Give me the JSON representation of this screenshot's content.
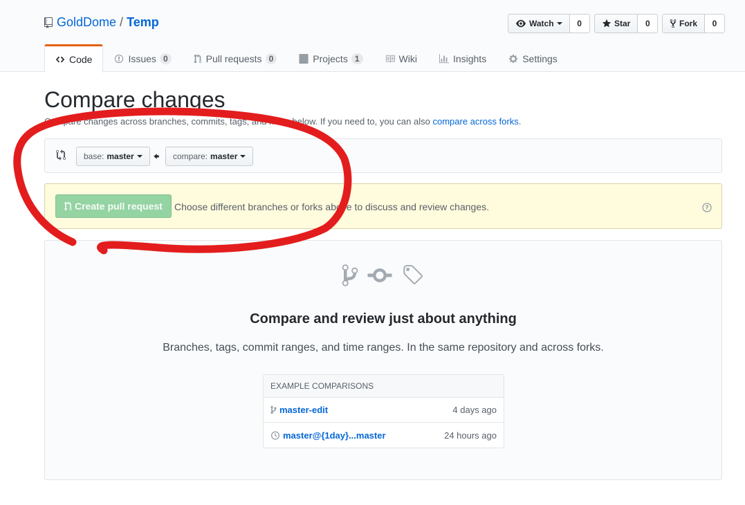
{
  "repo": {
    "owner": "GoldDome",
    "separator": "/",
    "name": "Temp"
  },
  "actions": {
    "watch": {
      "label": "Watch",
      "count": "0"
    },
    "star": {
      "label": "Star",
      "count": "0"
    },
    "fork": {
      "label": "Fork",
      "count": "0"
    }
  },
  "tabs": [
    {
      "label": "Code",
      "icon": "code-icon",
      "selected": true
    },
    {
      "label": "Issues",
      "count": "0",
      "icon": "issue-icon"
    },
    {
      "label": "Pull requests",
      "count": "0",
      "icon": "git-pull-request-icon"
    },
    {
      "label": "Projects",
      "count": "1",
      "icon": "project-icon"
    },
    {
      "label": "Wiki",
      "icon": "book-icon"
    },
    {
      "label": "Insights",
      "icon": "graph-icon"
    },
    {
      "label": "Settings",
      "icon": "gear-icon"
    }
  ],
  "page": {
    "title": "Compare changes",
    "subtitle_prefix": "Compare changes across branches, commits, tags, and more below. If you need to, you can also ",
    "subtitle_link": "compare across forks",
    "subtitle_suffix": "."
  },
  "range": {
    "base_label": "base:",
    "base_value": "master",
    "compare_label": "compare:",
    "compare_value": "master"
  },
  "flash": {
    "button_label": "Create pull request",
    "message": "Choose different branches or forks above to discuss and review changes."
  },
  "blankslate": {
    "title": "Compare and review just about anything",
    "text": "Branches, tags, commit ranges, and time ranges. In the same repository and across forks."
  },
  "examples": {
    "header": "Example comparisons",
    "rows": [
      {
        "label": "master-edit",
        "time": "4 days ago",
        "icon": "git-branch-icon"
      },
      {
        "label": "master@{1day}...master",
        "time": "24 hours ago",
        "icon": "history-icon"
      }
    ]
  },
  "colors": {
    "link": "#0366d6",
    "tab_accent": "#e36209",
    "create_button": "#94d3a2",
    "flash_bg": "#fffbdd",
    "annotation": "#e31d1d"
  }
}
